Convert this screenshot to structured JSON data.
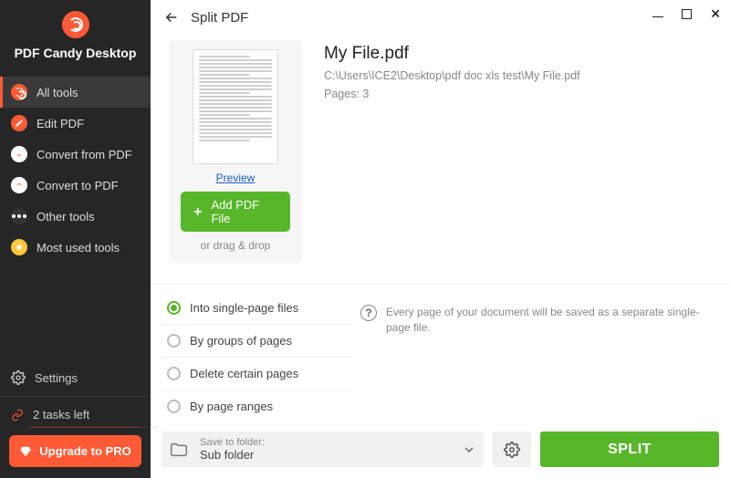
{
  "app": {
    "title": "PDF Candy Desktop"
  },
  "sidebar": {
    "items": [
      {
        "label": "All tools"
      },
      {
        "label": "Edit PDF"
      },
      {
        "label": "Convert from PDF"
      },
      {
        "label": "Convert to PDF"
      },
      {
        "label": "Other tools"
      },
      {
        "label": "Most used tools"
      }
    ],
    "settings_label": "Settings",
    "tasks_label": "2 tasks left",
    "upgrade_label": "Upgrade to PRO"
  },
  "header": {
    "title": "Split PDF"
  },
  "file": {
    "name": "My File.pdf",
    "path": "C:\\Users\\ICE2\\Desktop\\pdf doc xls test\\My File.pdf",
    "pages": "Pages: 3",
    "preview_label": "Preview",
    "add_label": "Add PDF File",
    "drag_label": "or drag & drop"
  },
  "options": {
    "items": [
      {
        "label": "Into single-page files",
        "checked": true
      },
      {
        "label": "By groups of pages",
        "checked": false
      },
      {
        "label": "Delete certain pages",
        "checked": false
      },
      {
        "label": "By page ranges",
        "checked": false
      }
    ],
    "description": "Every page of your document will be saved as a separate single-page file."
  },
  "footer": {
    "save_title": "Save to folder:",
    "save_value": "Sub folder",
    "split_label": "SPLIT"
  }
}
